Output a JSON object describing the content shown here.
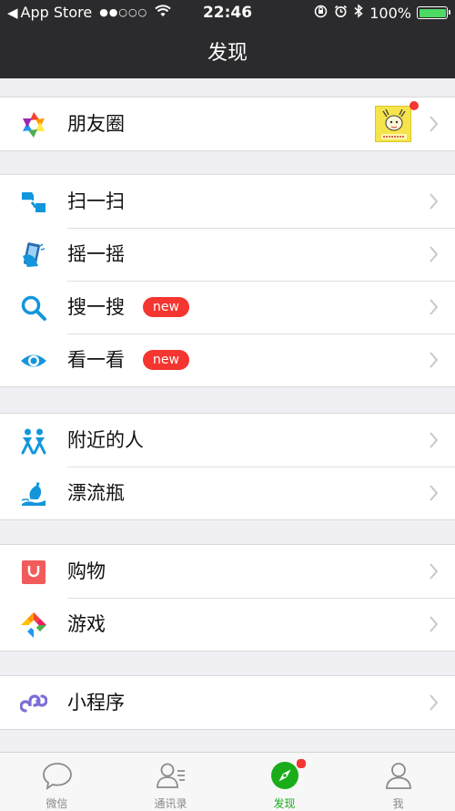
{
  "status_bar": {
    "back_app": "App Store",
    "signal": "●●○○○",
    "time": "22:46",
    "battery_percent": "100%"
  },
  "nav": {
    "title": "发现"
  },
  "groups": [
    [
      {
        "label": "朋友圈",
        "icon": "moments-aperture-icon",
        "thumbnail_dot": true
      }
    ],
    [
      {
        "label": "扫一扫",
        "icon": "scan-icon"
      },
      {
        "label": "摇一摇",
        "icon": "shake-icon"
      },
      {
        "label": "搜一搜",
        "icon": "search-icon",
        "badge": "new"
      },
      {
        "label": "看一看",
        "icon": "eye-icon",
        "badge": "new"
      }
    ],
    [
      {
        "label": "附近的人",
        "icon": "people-nearby-icon"
      },
      {
        "label": "漂流瓶",
        "icon": "drift-bottle-icon"
      }
    ],
    [
      {
        "label": "购物",
        "icon": "shopping-bag-icon"
      },
      {
        "label": "游戏",
        "icon": "game-icon"
      }
    ],
    [
      {
        "label": "小程序",
        "icon": "mini-program-icon"
      }
    ]
  ],
  "tabbar": {
    "tabs": [
      {
        "label": "微信",
        "icon": "chat-bubble-icon",
        "active": false
      },
      {
        "label": "通讯录",
        "icon": "contacts-icon",
        "active": false
      },
      {
        "label": "发现",
        "icon": "compass-icon",
        "active": true,
        "dot": true
      },
      {
        "label": "我",
        "icon": "me-person-icon",
        "active": false
      }
    ]
  },
  "colors": {
    "accent_green": "#1aad19",
    "badge_red": "#f43530",
    "nav_bg": "#2b2b2d",
    "page_bg": "#efeff4"
  }
}
